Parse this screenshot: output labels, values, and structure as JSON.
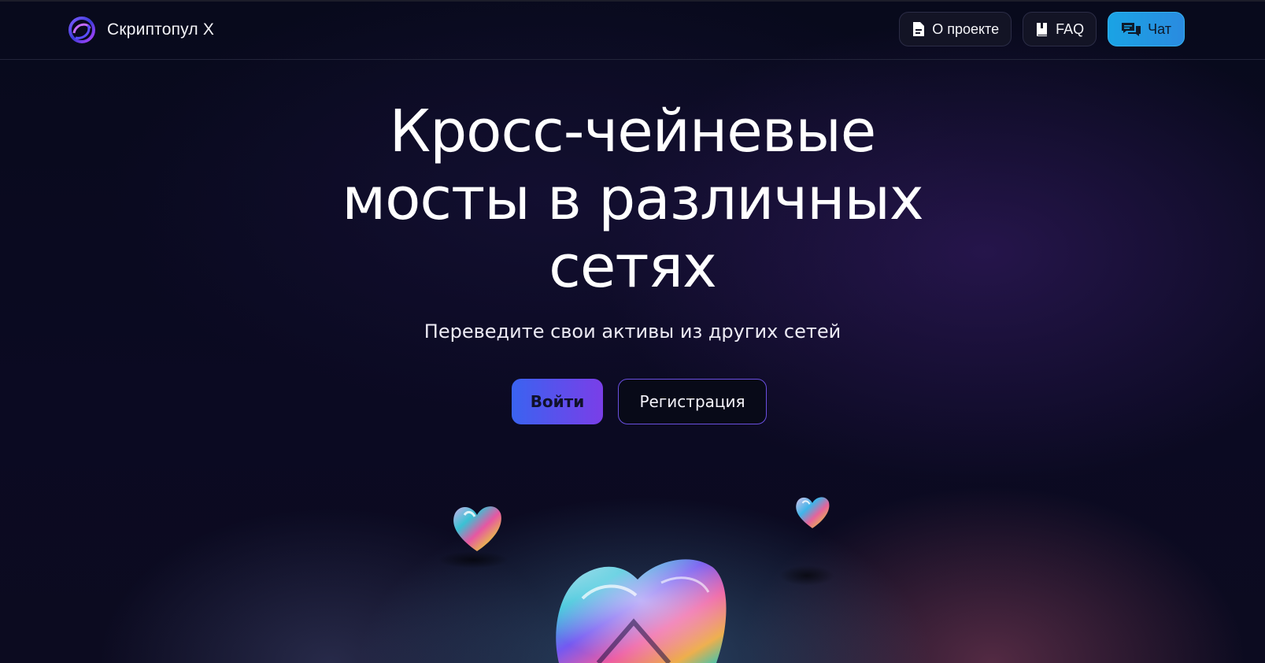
{
  "brand": {
    "name": "Скриптопул X",
    "logo_icon": "swirl-logo-icon"
  },
  "nav": {
    "about": {
      "label": "О проекте",
      "icon": "document-icon"
    },
    "faq": {
      "label": "FAQ",
      "icon": "book-icon"
    },
    "chat": {
      "label": "Чат",
      "icon": "chat-bubbles-icon"
    }
  },
  "hero": {
    "title_line1": "Кросс-чейневые",
    "title_line2": "мосты в различных",
    "title_line3": "сетях",
    "subtitle": "Переведите свои активы из других сетей",
    "login_label": "Войти",
    "register_label": "Регистрация"
  },
  "colors": {
    "background": "#07091a",
    "chat_accent": "#1aa3e4",
    "login_gradient_start": "#3a63f0",
    "login_gradient_end": "#7a3ee8",
    "register_border": "#6a4fe0"
  },
  "decorations": {
    "hearts": [
      "iridescent-glass-heart",
      "iridescent-glass-heart",
      "iridescent-glass-heart"
    ]
  }
}
